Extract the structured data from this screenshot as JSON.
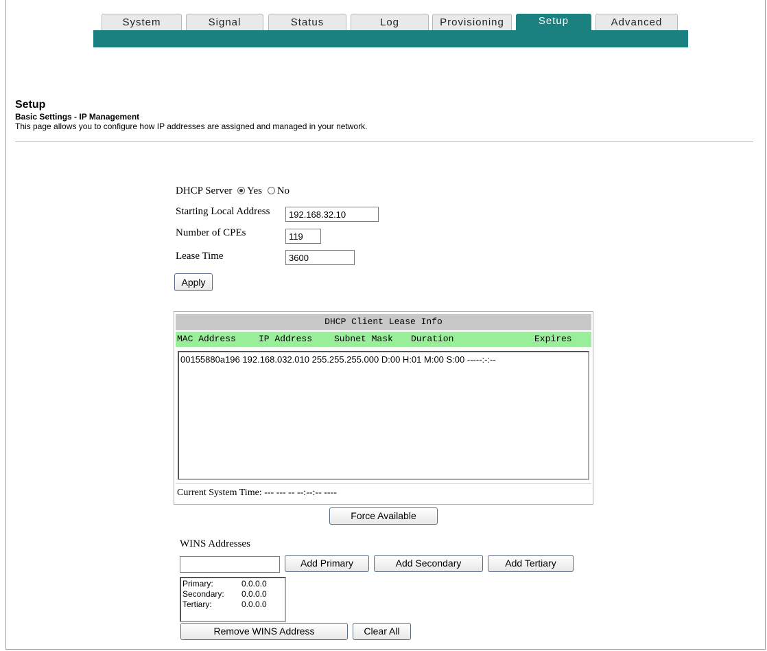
{
  "tabs": [
    {
      "label": "System",
      "active": false
    },
    {
      "label": "Signal",
      "active": false
    },
    {
      "label": "Status",
      "active": false
    },
    {
      "label": "Log",
      "active": false
    },
    {
      "label": "Provisioning",
      "active": false
    },
    {
      "label": "Setup",
      "active": true
    },
    {
      "label": "Advanced",
      "active": false
    }
  ],
  "header": {
    "title": "Setup",
    "subtitle": "Basic Settings - IP Management",
    "description": "This page allows you to configure how IP addresses are assigned and managed in your network."
  },
  "dhcp": {
    "server_label": "DHCP Server",
    "yes_label": "Yes",
    "no_label": "No",
    "selected": "Yes",
    "start_label": "Starting Local Address",
    "start_value": "192.168.32.10",
    "cpes_label": "Number of CPEs",
    "cpes_value": "119",
    "lease_label": "Lease Time",
    "lease_value": "3600",
    "apply_label": "Apply"
  },
  "lease_table": {
    "title": "DHCP Client Lease Info",
    "columns": [
      "MAC Address",
      "IP Address",
      "Subnet Mask",
      "Duration",
      "Expires"
    ],
    "rows": [
      {
        "mac": "00155880a196",
        "ip": "192.168.032.010",
        "mask": "255.255.255.000",
        "duration": "D:00 H:01 M:00 S:00",
        "expires": "-----:-:--"
      }
    ],
    "current_time_label": "Current System Time: --- --- -- --:--:-- ----",
    "force_label": "Force Available"
  },
  "wins": {
    "label": "WINS Addresses",
    "input_value": "",
    "add_primary": "Add Primary",
    "add_secondary": "Add Secondary",
    "add_tertiary": "Add Tertiary",
    "entries": [
      {
        "label": "Primary:",
        "value": "0.0.0.0"
      },
      {
        "label": "Secondary:",
        "value": "0.0.0.0"
      },
      {
        "label": "Tertiary:",
        "value": "0.0.0.0"
      }
    ],
    "remove_label": "Remove WINS Address",
    "clear_label": "Clear All"
  },
  "colors": {
    "accent": "#1a8080",
    "table_header": "#c8c8c8",
    "column_header": "#99ee99"
  }
}
